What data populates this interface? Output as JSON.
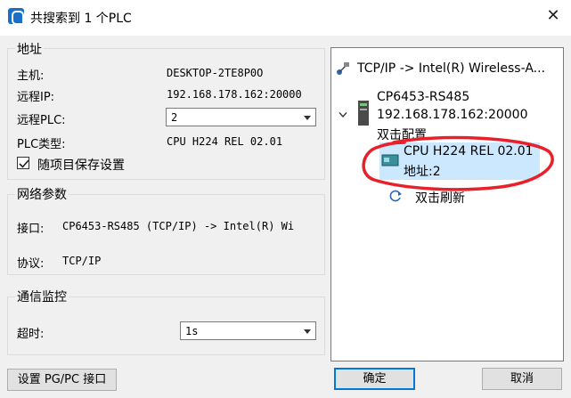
{
  "window": {
    "title": "共搜索到 1 个PLC",
    "close_symbol": "✕"
  },
  "address_group": {
    "title": "地址",
    "host_label": "主机:",
    "host_value": "DESKTOP-2TE8P0O",
    "remote_ip_label": "远程IP:",
    "remote_ip_value": "192.168.178.162:20000",
    "remote_plc_label": "远程PLC:",
    "remote_plc_value": "2",
    "plc_type_label": "PLC类型:",
    "plc_type_value": "CPU H224 REL 02.01",
    "save_checkbox_label": "随项目保存设置",
    "save_checked": true
  },
  "network_group": {
    "title": "网络参数",
    "interface_label": "接口:",
    "interface_value": "CP6453-RS485 (TCP/IP) -> Intel(R) Wi",
    "protocol_label": "协议:",
    "protocol_value": "TCP/IP"
  },
  "comm_group": {
    "title": "通信监控",
    "timeout_label": "超时:",
    "timeout_value": "1s"
  },
  "tree": {
    "root_label": "TCP/IP -> Intel(R) Wireless-A...",
    "device_name": "CP6453-RS485",
    "device_address": "192.168.178.162:20000",
    "device_action": "双击配置",
    "plc_name": "CPU H224 REL 02.01",
    "plc_address": "地址:2",
    "refresh_label": "双击刷新"
  },
  "buttons": {
    "set_pgpc": "设置 PG/PC 接口",
    "ok": "确定",
    "cancel": "取消"
  },
  "colors": {
    "selection": "#cce8ff",
    "annotation": "#e8202a",
    "accent": "#0078d7"
  }
}
